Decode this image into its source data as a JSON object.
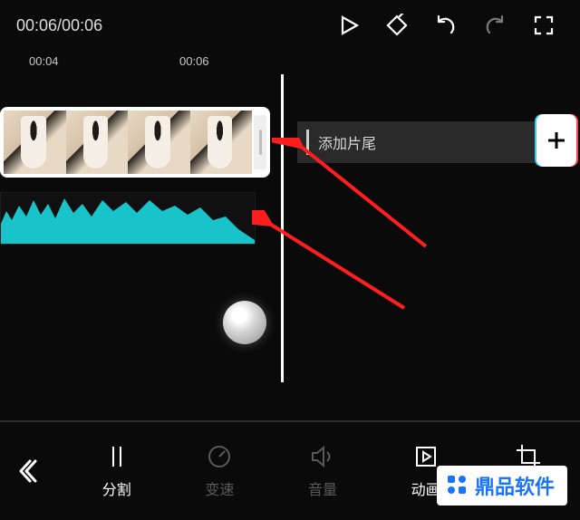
{
  "top": {
    "timecode": "00:06/00:06"
  },
  "ruler": {
    "t1": "00:04",
    "t2": "00:06"
  },
  "timeline": {
    "ending_label": "添加片尾"
  },
  "tools": {
    "split": "分割",
    "speed": "变速",
    "volume": "音量",
    "anim": "动画",
    "crop": "裁剪"
  },
  "watermark": {
    "text": "鼎品软件"
  }
}
